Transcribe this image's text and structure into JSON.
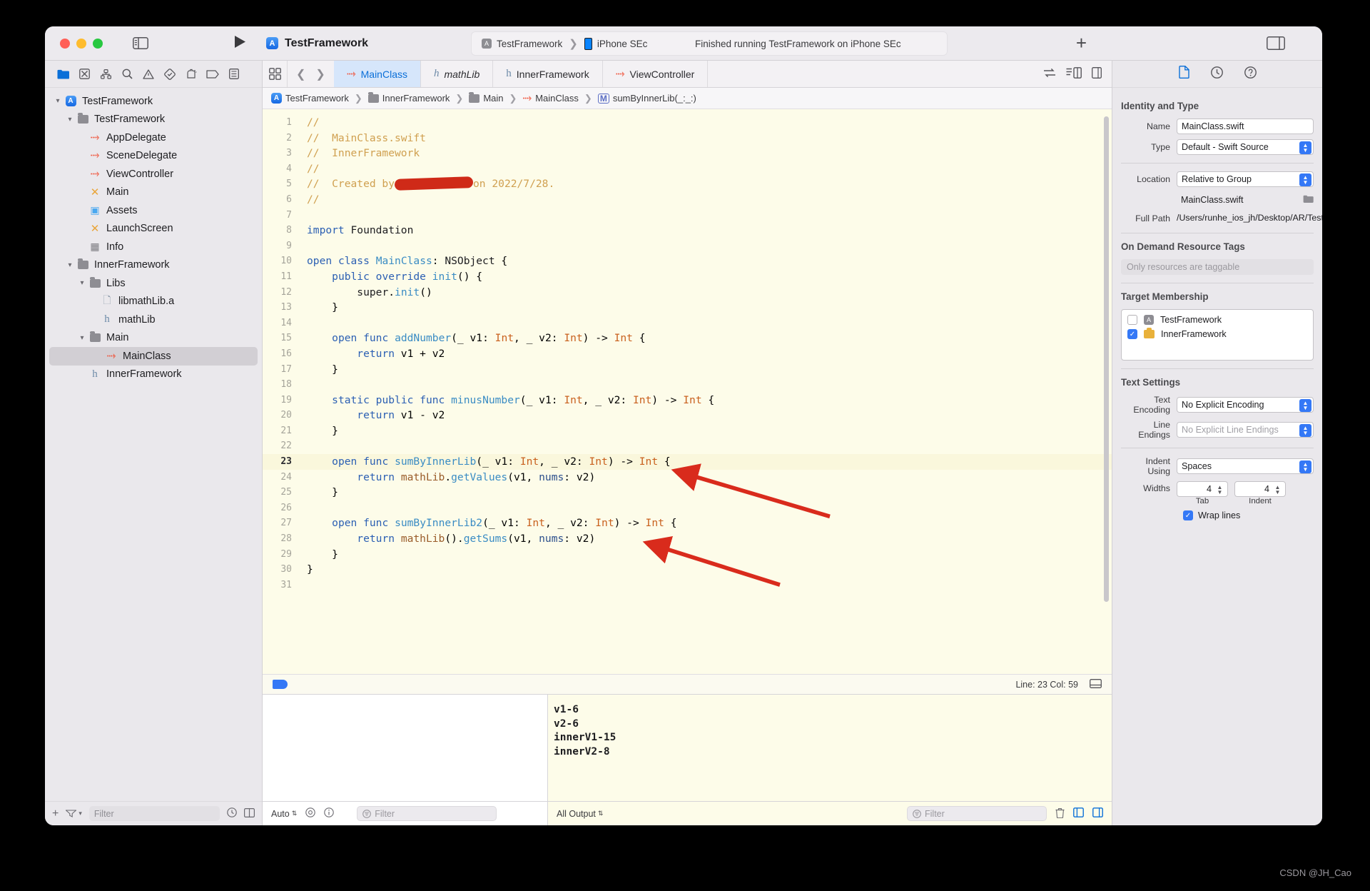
{
  "window": {
    "project_title": "TestFramework",
    "scheme": "TestFramework",
    "device": "iPhone SEc",
    "status_message": "Finished running TestFramework on iPhone SEc"
  },
  "navigator": {
    "toolbar_icons": [
      "folder-icon",
      "source-control-icon",
      "hierarchy-icon",
      "search-icon",
      "warning-icon",
      "test-icon",
      "debug-icon",
      "breakpoint-icon",
      "report-icon"
    ],
    "tree": [
      {
        "label": "TestFramework",
        "indent": 0,
        "icon": "app-icon",
        "twisty": "open",
        "selected": false
      },
      {
        "label": "TestFramework",
        "indent": 1,
        "icon": "folder-icon",
        "twisty": "open",
        "selected": false
      },
      {
        "label": "AppDelegate",
        "indent": 2,
        "icon": "swift-icon",
        "twisty": "",
        "selected": false
      },
      {
        "label": "SceneDelegate",
        "indent": 2,
        "icon": "swift-icon",
        "twisty": "",
        "selected": false
      },
      {
        "label": "ViewController",
        "indent": 2,
        "icon": "swift-icon",
        "twisty": "",
        "selected": false
      },
      {
        "label": "Main",
        "indent": 2,
        "icon": "storyboard-icon",
        "twisty": "",
        "selected": false
      },
      {
        "label": "Assets",
        "indent": 2,
        "icon": "assets-icon",
        "twisty": "",
        "selected": false
      },
      {
        "label": "LaunchScreen",
        "indent": 2,
        "icon": "storyboard-icon",
        "twisty": "",
        "selected": false
      },
      {
        "label": "Info",
        "indent": 2,
        "icon": "plist-icon",
        "twisty": "",
        "selected": false
      },
      {
        "label": "InnerFramework",
        "indent": 1,
        "icon": "folder-icon",
        "twisty": "open",
        "selected": false
      },
      {
        "label": "Libs",
        "indent": 2,
        "icon": "folder-icon",
        "twisty": "open",
        "selected": false
      },
      {
        "label": "libmathLib.a",
        "indent": 3,
        "icon": "document-icon",
        "twisty": "",
        "selected": false
      },
      {
        "label": "mathLib",
        "indent": 3,
        "icon": "header-icon",
        "twisty": "",
        "selected": false
      },
      {
        "label": "Main",
        "indent": 2,
        "icon": "folder-icon",
        "twisty": "open",
        "selected": false
      },
      {
        "label": "MainClass",
        "indent": 3,
        "icon": "swift-icon",
        "twisty": "",
        "selected": true
      },
      {
        "label": "InnerFramework",
        "indent": 2,
        "icon": "header-icon",
        "twisty": "",
        "selected": false
      }
    ],
    "footer": {
      "add_label": "+",
      "filter_placeholder": "Filter"
    }
  },
  "editor": {
    "tabs": [
      {
        "label": "MainClass",
        "icon": "swift-icon",
        "active": true,
        "italic": false
      },
      {
        "label": "mathLib",
        "icon": "header-icon",
        "active": false,
        "italic": true
      },
      {
        "label": "InnerFramework",
        "icon": "header-icon",
        "active": false,
        "italic": false
      },
      {
        "label": "ViewController",
        "icon": "swift-icon",
        "active": false,
        "italic": false
      }
    ],
    "breadcrumb": [
      {
        "label": "TestFramework",
        "icon": "app-icon"
      },
      {
        "label": "InnerFramework",
        "icon": "folder-icon"
      },
      {
        "label": "Main",
        "icon": "folder-icon"
      },
      {
        "label": "MainClass",
        "icon": "swift-icon"
      },
      {
        "label": "sumByInnerLib(_:_:)",
        "icon": "method-icon"
      }
    ],
    "lines": [
      {
        "n": 1,
        "text": "//",
        "hl": false
      },
      {
        "n": 2,
        "text": "//  MainClass.swift",
        "hl": false
      },
      {
        "n": 3,
        "text": "//  InnerFramework",
        "hl": false
      },
      {
        "n": 4,
        "text": "//",
        "hl": false
      },
      {
        "n": 5,
        "text": "//  Created by            on 2022/7/28.",
        "hl": false,
        "redacted": true
      },
      {
        "n": 6,
        "text": "//",
        "hl": false
      },
      {
        "n": 7,
        "text": "",
        "hl": false
      },
      {
        "n": 8,
        "text": "import Foundation",
        "hl": false
      },
      {
        "n": 9,
        "text": "",
        "hl": false
      },
      {
        "n": 10,
        "text": "open class MainClass: NSObject {",
        "hl": false
      },
      {
        "n": 11,
        "text": "    public override init() {",
        "hl": false
      },
      {
        "n": 12,
        "text": "        super.init()",
        "hl": false
      },
      {
        "n": 13,
        "text": "    }",
        "hl": false
      },
      {
        "n": 14,
        "text": "",
        "hl": false
      },
      {
        "n": 15,
        "text": "    open func addNumber(_ v1: Int, _ v2: Int) -> Int {",
        "hl": false
      },
      {
        "n": 16,
        "text": "        return v1 + v2",
        "hl": false
      },
      {
        "n": 17,
        "text": "    }",
        "hl": false
      },
      {
        "n": 18,
        "text": "",
        "hl": false
      },
      {
        "n": 19,
        "text": "    static public func minusNumber(_ v1: Int, _ v2: Int) -> Int {",
        "hl": false
      },
      {
        "n": 20,
        "text": "        return v1 - v2",
        "hl": false
      },
      {
        "n": 21,
        "text": "    }",
        "hl": false
      },
      {
        "n": 22,
        "text": "",
        "hl": false
      },
      {
        "n": 23,
        "text": "    open func sumByInnerLib(_ v1: Int, _ v2: Int) -> Int {",
        "hl": true
      },
      {
        "n": 24,
        "text": "        return mathLib.getValues(v1, nums: v2)",
        "hl": false
      },
      {
        "n": 25,
        "text": "    }",
        "hl": false
      },
      {
        "n": 26,
        "text": "",
        "hl": false
      },
      {
        "n": 27,
        "text": "    open func sumByInnerLib2(_ v1: Int, _ v2: Int) -> Int {",
        "hl": false
      },
      {
        "n": 28,
        "text": "        return mathLib().getSums(v1, nums: v2)",
        "hl": false
      },
      {
        "n": 29,
        "text": "    }",
        "hl": false
      },
      {
        "n": 30,
        "text": "}",
        "hl": false
      },
      {
        "n": 31,
        "text": "",
        "hl": false
      }
    ],
    "status": {
      "line_col": "Line: 23  Col: 59"
    }
  },
  "debug": {
    "console_output": [
      "v1-6",
      "v2-6",
      "innerV1-15",
      "innerV2-8"
    ],
    "left_bar": {
      "auto_label": "Auto",
      "filter_placeholder": "Filter"
    },
    "right_bar": {
      "output_label": "All Output",
      "filter_placeholder": "Filter"
    }
  },
  "inspector": {
    "toolbar_icons": [
      "file-inspector-icon",
      "history-inspector-icon",
      "quick-help-icon"
    ],
    "identity": {
      "section_title": "Identity and Type",
      "name_label": "Name",
      "name_value": "MainClass.swift",
      "type_label": "Type",
      "type_value": "Default - Swift Source",
      "location_label": "Location",
      "location_value": "Relative to Group",
      "file_name": "MainClass.swift",
      "full_path_label": "Full Path",
      "full_path_value": "/Users/runhe_ios_jh/Desktop/AR/TestFramework/InnerFramework/Main/MainClass.swift"
    },
    "odr": {
      "section_title": "On Demand Resource Tags",
      "placeholder": "Only resources are taggable"
    },
    "target_membership": {
      "section_title": "Target Membership",
      "targets": [
        {
          "label": "TestFramework",
          "checked": false,
          "icon": "app-target-icon"
        },
        {
          "label": "InnerFramework",
          "checked": true,
          "icon": "framework-target-icon"
        }
      ]
    },
    "text_settings": {
      "section_title": "Text Settings",
      "encoding_label": "Text Encoding",
      "encoding_value": "No Explicit Encoding",
      "line_endings_label": "Line Endings",
      "line_endings_value": "No Explicit Line Endings",
      "indent_label": "Indent Using",
      "indent_value": "Spaces",
      "widths_label": "Widths",
      "tab_value": "4",
      "indent_value_num": "4",
      "tab_caption": "Tab",
      "indent_caption": "Indent",
      "wrap_label": "Wrap lines",
      "wrap_checked": true
    }
  },
  "watermark": "CSDN @JH_Cao",
  "colors": {
    "accent": "#3478f6",
    "swift_orange": "#f05138",
    "arrow_red": "#d92b1c",
    "editor_bg": "#fdfce9"
  }
}
